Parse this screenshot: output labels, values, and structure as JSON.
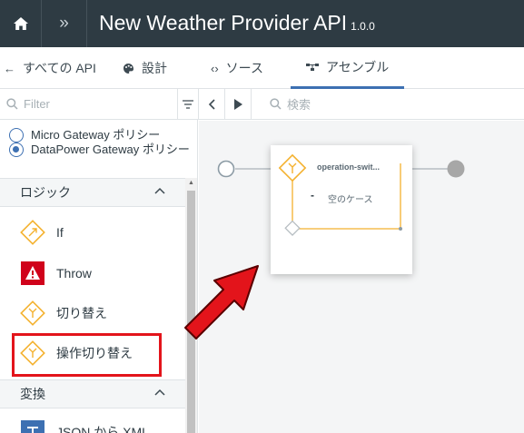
{
  "header": {
    "title": "New Weather Provider API",
    "version": "1.0.0"
  },
  "tabs": [
    {
      "label": "すべての API",
      "icon": "arrow-left-icon"
    },
    {
      "label": "設計",
      "icon": "palette-icon"
    },
    {
      "label": "ソース",
      "icon": "code-icon"
    },
    {
      "label": "アセンブル",
      "icon": "flow-icon",
      "active": true
    }
  ],
  "toolbar": {
    "filter_placeholder": "Filter",
    "search_placeholder": "検索"
  },
  "gateway_options": [
    {
      "label": "Micro Gateway ポリシー",
      "checked": false
    },
    {
      "label": "DataPower Gateway ポリシー",
      "checked": true
    }
  ],
  "sections": [
    {
      "title": "ロジック",
      "items": [
        {
          "label": "If",
          "icon": "if-icon"
        },
        {
          "label": "Throw",
          "icon": "throw-icon"
        },
        {
          "label": "切り替え",
          "icon": "switch-icon"
        },
        {
          "label": "操作切り替え",
          "icon": "operation-switch-icon"
        }
      ]
    },
    {
      "title": "変換",
      "items": [
        {
          "label": "JSON から XML",
          "icon": "json-to-xml-icon"
        }
      ]
    }
  ],
  "canvas": {
    "policy_title": "operation-swit...",
    "case_label": "空のケース"
  },
  "colors": {
    "topbar": "#2e3b43",
    "accent": "#3d70b2",
    "policy_orange": "#f4b12e",
    "highlight_red": "#e3141b",
    "arrow_red": "#e3141b"
  }
}
